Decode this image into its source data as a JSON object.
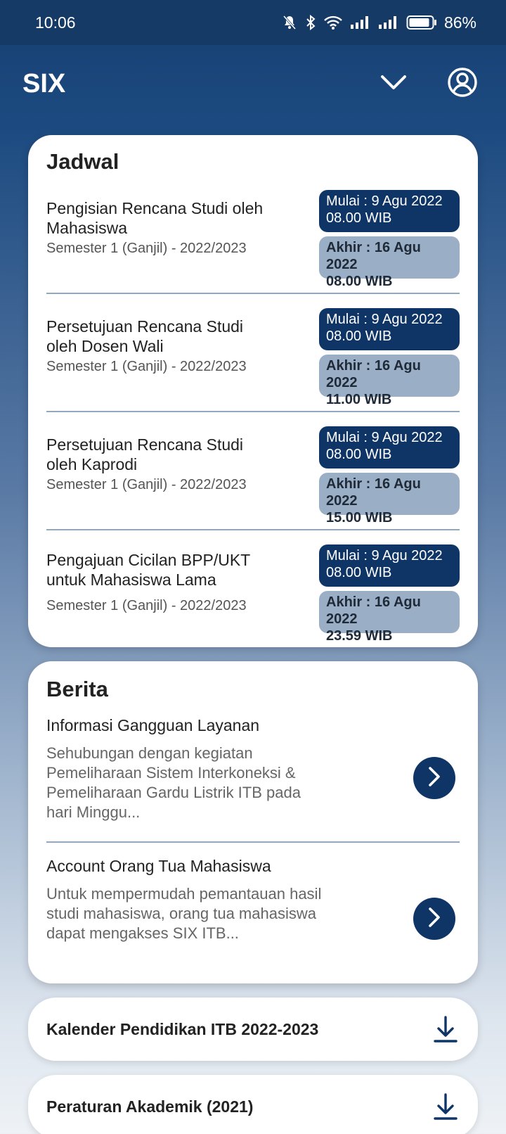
{
  "status_bar": {
    "time": "10:06",
    "battery": "86%",
    "icons": [
      "bell-muted-icon",
      "bluetooth-icon",
      "wifi-icon",
      "signal-icon",
      "signal-icon",
      "battery-icon"
    ]
  },
  "app": {
    "title": "SIX",
    "menu_icon": "chevron-down-icon",
    "profile_icon": "profile-icon"
  },
  "jadwal": {
    "title": "Jadwal",
    "items": [
      {
        "name": "Pengisian Rencana Studi oleh Mahasiswa",
        "semester": "Semester 1 (Ganjil) - 2022/2023",
        "start_line1": "Mulai : 9 Agu 2022",
        "start_line2": "08.00 WIB",
        "end_line1": "Akhir : 16 Agu 2022",
        "end_line2": "08.00 WIB"
      },
      {
        "name": "Persetujuan Rencana Studi oleh Dosen Wali",
        "semester": "Semester 1 (Ganjil) - 2022/2023",
        "start_line1": "Mulai : 9 Agu 2022",
        "start_line2": "08.00 WIB",
        "end_line1": "Akhir : 16 Agu 2022",
        "end_line2": "11.00 WIB"
      },
      {
        "name": "Persetujuan Rencana Studi oleh Kaprodi",
        "semester": "Semester 1 (Ganjil) - 2022/2023",
        "start_line1": "Mulai : 9 Agu 2022",
        "start_line2": "08.00 WIB",
        "end_line1": "Akhir : 16 Agu 2022",
        "end_line2": "15.00 WIB"
      },
      {
        "name": "Pengajuan Cicilan BPP/UKT untuk Mahasiswa Lama",
        "semester": "Semester 1 (Ganjil) - 2022/2023",
        "start_line1": "Mulai : 9 Agu 2022",
        "start_line2": "08.00 WIB",
        "end_line1": "Akhir : 16 Agu 2022",
        "end_line2": "23.59 WIB"
      }
    ]
  },
  "berita": {
    "title": "Berita",
    "items": [
      {
        "title": "Informasi Gangguan Layanan",
        "desc": "Sehubungan dengan kegiatan Pemeliharaan Sistem Interkoneksi & Pemeliharaan Gardu Listrik ITB pada hari Minggu..."
      },
      {
        "title": "Account Orang Tua Mahasiswa",
        "desc": "Untuk mempermudah pemantauan hasil studi mahasiswa, orang tua mahasiswa dapat mengakses SIX ITB..."
      }
    ]
  },
  "downloads": [
    {
      "title": "Kalender Pendidikan ITB 2022-2023",
      "icon": "download-icon"
    },
    {
      "title": "Peraturan Akademik (2021)",
      "icon": "download-icon"
    }
  ],
  "colors": {
    "primary": "#0f3566",
    "badge_end": "#9aaec5",
    "header": "#163a66"
  }
}
